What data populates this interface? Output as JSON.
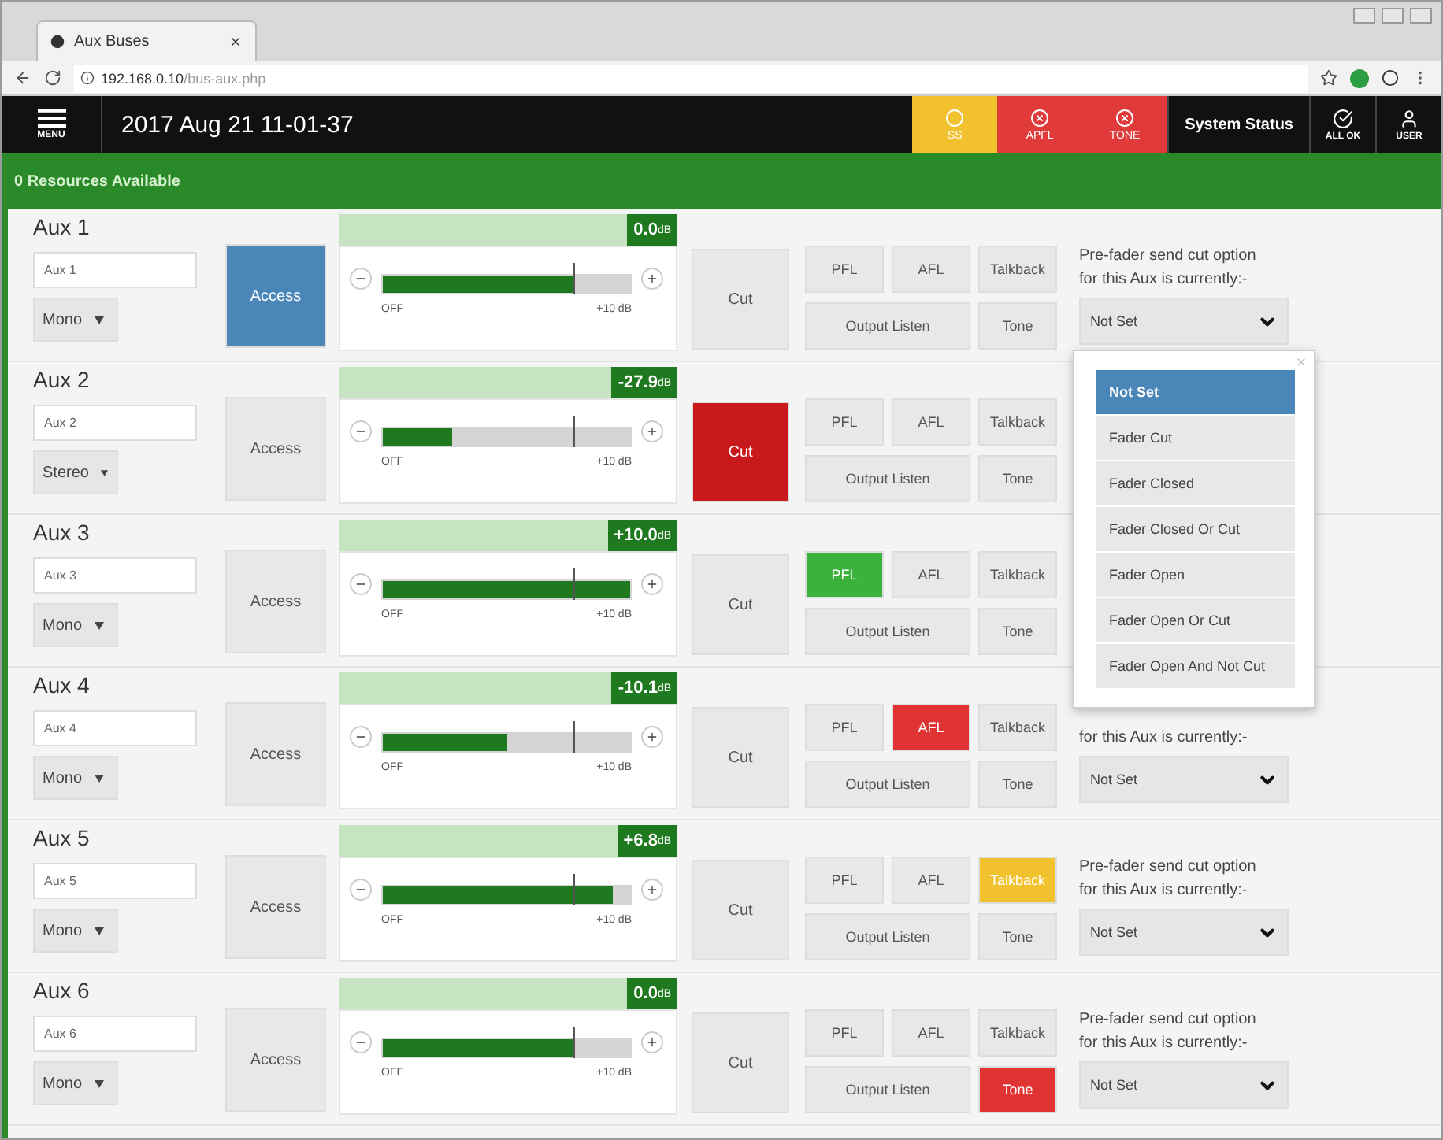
{
  "browser": {
    "tab_title": "Aux Buses",
    "url_host": "192.168.0.10",
    "url_path": "/bus-aux.php"
  },
  "header": {
    "menu_label": "MENU",
    "datetime": "2017 Aug 21 11-01-37",
    "system_status": "System Status",
    "status_tiles": [
      {
        "kind": "warning",
        "label": "SS",
        "color": "#f2c12e"
      },
      {
        "kind": "error",
        "label": "APFL",
        "color": "#e03a3a"
      },
      {
        "kind": "error",
        "label": "TONE",
        "color": "#e03a3a"
      }
    ],
    "ok_label": "ALL OK",
    "user_label": "USER"
  },
  "resources": "0 Resources Available",
  "aux_buses": [
    {
      "title": "Aux 1",
      "name": "Aux 1",
      "mode": "Mono",
      "access_selected": true,
      "reading": "0.0",
      "unit": "dB",
      "level": 0.77,
      "off_label": "OFF",
      "max_label": "+10 dB",
      "cut_label": "Cut",
      "cut_on": false,
      "buttons": [
        {
          "kind": "pfl",
          "label": "PFL",
          "on": false
        },
        {
          "kind": "afl",
          "label": "AFL",
          "on": false
        },
        {
          "kind": "talkback",
          "label": "Talkback",
          "on": false
        },
        {
          "kind": "listen",
          "label": "Output Listen",
          "on": false
        },
        {
          "kind": "tone",
          "label": "Tone",
          "on": false
        }
      ],
      "access_label": "Access",
      "prefader": {
        "lines": [
          "Pre-fader send cut option",
          "for this Aux is currently:-"
        ],
        "value": "Not Set"
      }
    },
    {
      "title": "Aux 2",
      "name": "Aux 2",
      "mode": "Stereo",
      "access_selected": false,
      "reading": "-27.9",
      "unit": "dB",
      "level": 0.28,
      "off_label": "OFF",
      "max_label": "+10 dB",
      "cut_label": "Cut",
      "cut_on": true,
      "buttons": [
        {
          "kind": "pfl",
          "label": "PFL",
          "on": false
        },
        {
          "kind": "afl",
          "label": "AFL",
          "on": false
        },
        {
          "kind": "talkback",
          "label": "Talkback",
          "on": false
        },
        {
          "kind": "listen",
          "label": "Output Listen",
          "on": false
        },
        {
          "kind": "tone",
          "label": "Tone",
          "on": false
        }
      ],
      "access_label": "Access"
    },
    {
      "title": "Aux 3",
      "name": "Aux 3",
      "mode": "Mono",
      "access_selected": false,
      "reading": "+10.0",
      "unit": "dB",
      "level": 1.0,
      "off_label": "OFF",
      "max_label": "+10 dB",
      "cut_label": "Cut",
      "cut_on": false,
      "buttons": [
        {
          "kind": "pfl",
          "label": "PFL",
          "on": true
        },
        {
          "kind": "afl",
          "label": "AFL",
          "on": false
        },
        {
          "kind": "talkback",
          "label": "Talkback",
          "on": false
        },
        {
          "kind": "listen",
          "label": "Output Listen",
          "on": false
        },
        {
          "kind": "tone",
          "label": "Tone",
          "on": false
        }
      ],
      "access_label": "Access"
    },
    {
      "title": "Aux 4",
      "name": "Aux 4",
      "mode": "Mono",
      "access_selected": false,
      "reading": "-10.1",
      "unit": "dB",
      "level": 0.5,
      "off_label": "OFF",
      "max_label": "+10 dB",
      "cut_label": "Cut",
      "cut_on": false,
      "buttons": [
        {
          "kind": "pfl",
          "label": "PFL",
          "on": false
        },
        {
          "kind": "afl",
          "label": "AFL",
          "on": true
        },
        {
          "kind": "talkback",
          "label": "Talkback",
          "on": false
        },
        {
          "kind": "listen",
          "label": "Output Listen",
          "on": false
        },
        {
          "kind": "tone",
          "label": "Tone",
          "on": false
        }
      ],
      "access_label": "Access",
      "prefader": {
        "lines": [
          "for this Aux is currently:-"
        ],
        "value": "Not Set"
      }
    },
    {
      "title": "Aux 5",
      "name": "Aux 5",
      "mode": "Mono",
      "access_selected": false,
      "reading": "+6.8",
      "unit": "dB",
      "level": 0.93,
      "off_label": "OFF",
      "max_label": "+10 dB",
      "cut_label": "Cut",
      "cut_on": false,
      "buttons": [
        {
          "kind": "pfl",
          "label": "PFL",
          "on": false
        },
        {
          "kind": "afl",
          "label": "AFL",
          "on": false
        },
        {
          "kind": "talkback",
          "label": "Talkback",
          "on": true
        },
        {
          "kind": "listen",
          "label": "Output Listen",
          "on": false
        },
        {
          "kind": "tone",
          "label": "Tone",
          "on": false
        }
      ],
      "access_label": "Access",
      "prefader": {
        "lines": [
          "Pre-fader send cut option",
          "for this Aux is currently:-"
        ],
        "value": "Not Set"
      }
    },
    {
      "title": "Aux 6",
      "name": "Aux 6",
      "mode": "Mono",
      "access_selected": false,
      "reading": "0.0",
      "unit": "dB",
      "level": 0.77,
      "off_label": "OFF",
      "max_label": "+10 dB",
      "cut_label": "Cut",
      "cut_on": false,
      "buttons": [
        {
          "kind": "pfl",
          "label": "PFL",
          "on": false
        },
        {
          "kind": "afl",
          "label": "AFL",
          "on": false
        },
        {
          "kind": "talkback",
          "label": "Talkback",
          "on": false
        },
        {
          "kind": "listen",
          "label": "Output Listen",
          "on": false
        },
        {
          "kind": "tone",
          "label": "Tone",
          "on": true
        }
      ],
      "access_label": "Access",
      "prefader": {
        "lines": [
          "Pre-fader send cut option",
          "for this Aux is currently:-"
        ],
        "value": "Not Set"
      }
    }
  ],
  "cut_option_menu": {
    "options": [
      {
        "label": "Not Set",
        "selected": true
      },
      {
        "label": "Fader Cut",
        "selected": false
      },
      {
        "label": "Fader Closed",
        "selected": false
      },
      {
        "label": "Fader Closed Or Cut",
        "selected": false
      },
      {
        "label": "Fader Open",
        "selected": false
      },
      {
        "label": "Fader Open Or Cut",
        "selected": false
      },
      {
        "label": "Fader Open And Not Cut",
        "selected": false
      }
    ]
  }
}
